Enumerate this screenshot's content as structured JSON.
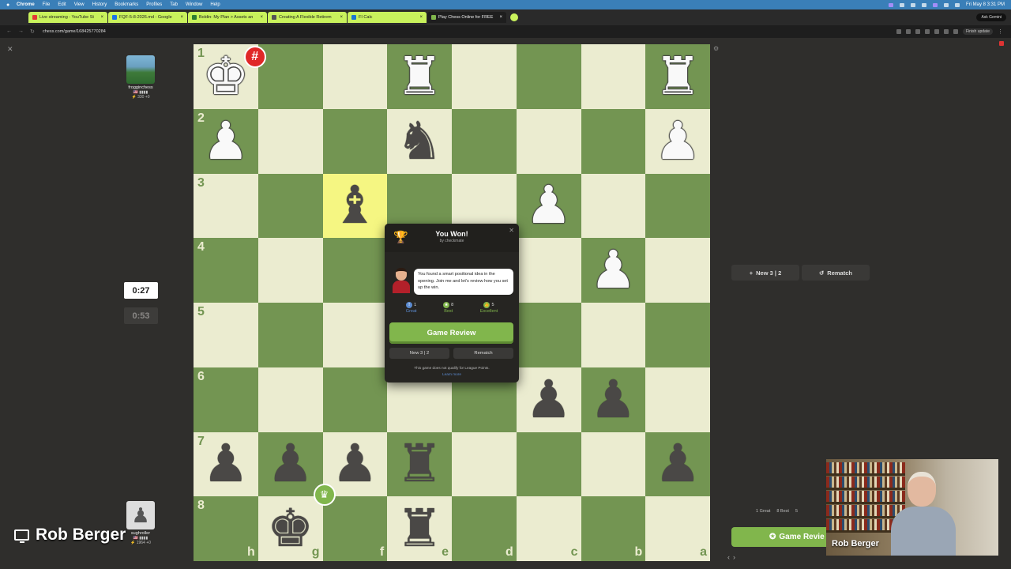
{
  "menubar": {
    "items": [
      "Chrome",
      "File",
      "Edit",
      "View",
      "History",
      "Bookmarks",
      "Profiles",
      "Tab",
      "Window",
      "Help"
    ],
    "clock": "Fri May 8  3:31 PM"
  },
  "tabs": [
    {
      "title": "Live streaming - YouTube St",
      "favicon_color": "#e53935",
      "active": false
    },
    {
      "title": "FQF-5-8-2026.md - Google",
      "favicon_color": "#1a73e8",
      "active": false
    },
    {
      "title": "Boldin: My Plan > Assets an",
      "favicon_color": "#2e7d32",
      "active": false
    },
    {
      "title": "Creating A Flexible Retirem",
      "favicon_color": "#555555",
      "active": false
    },
    {
      "title": "FI Calc",
      "favicon_color": "#1976d2",
      "active": false
    },
    {
      "title": "Play Chess Online for FREE",
      "favicon_color": "#81b64c",
      "active": true
    }
  ],
  "browser": {
    "url": "chess.com/game/168425770284",
    "ask_gemini": "Ask Gemini",
    "finish_update": "Finish update"
  },
  "top_player": {
    "name": "frogginchess",
    "flag": "🇺🇸 ▮▮▮▮",
    "rating": "330 +0",
    "clock": "0:27"
  },
  "bottom_player": {
    "name": "sughroller",
    "flag": "🇺🇸 ▮▮▮▮",
    "rating": "1964 +0",
    "clock": "0:53"
  },
  "board": {
    "ranks": [
      "1",
      "2",
      "3",
      "4",
      "5",
      "6",
      "7",
      "8"
    ],
    "files": [
      "h",
      "g",
      "f",
      "e",
      "d",
      "c",
      "b",
      "a"
    ],
    "highlight": "f3",
    "squares": [
      [
        "wK",
        "",
        "",
        "wR",
        "",
        "",
        "",
        "wR"
      ],
      [
        "wP",
        "",
        "",
        "bN",
        "",
        "",
        "",
        "wP"
      ],
      [
        "",
        "",
        "bB",
        "",
        "",
        "wP",
        "",
        ""
      ],
      [
        "",
        "",
        "",
        "",
        "",
        "",
        "wP",
        ""
      ],
      [
        "",
        "",
        "",
        "",
        "",
        "",
        "",
        ""
      ],
      [
        "",
        "",
        "",
        "",
        "",
        "bP",
        "bP",
        ""
      ],
      [
        "bP",
        "bP",
        "bP",
        "bR",
        "",
        "",
        "",
        "bP"
      ],
      [
        "",
        "bK",
        "",
        "bR",
        "",
        "",
        "",
        ""
      ]
    ],
    "checkmate_badge": "#",
    "winner_badge": "♛"
  },
  "modal": {
    "title": "You Won!",
    "subtitle": "by checkmate",
    "coach_text": "You found a smart positional idea in the opening. Join me and let's review how you set up the win.",
    "stats": [
      {
        "count": "1",
        "label": "Great",
        "icon": "!"
      },
      {
        "count": "8",
        "label": "Best",
        "icon": "★"
      },
      {
        "count": "5",
        "label": "Excellent",
        "icon": "👍"
      }
    ],
    "review_label": "Game Review",
    "new_game_label": "New 3 | 2",
    "rematch_label": "Rematch",
    "note": "This game does not qualify for League Points.",
    "learn_more": "Learn more"
  },
  "side_panel": {
    "new_game_label": "New 3 | 2",
    "rematch_label": "Rematch",
    "mini_great": "1 Great",
    "mini_best": "8 Best",
    "mini_excellent": "5",
    "review_label": "Game Revie"
  },
  "overlay": {
    "presenter_name": "Rob Berger",
    "webcam_label": "Rob Berger"
  }
}
